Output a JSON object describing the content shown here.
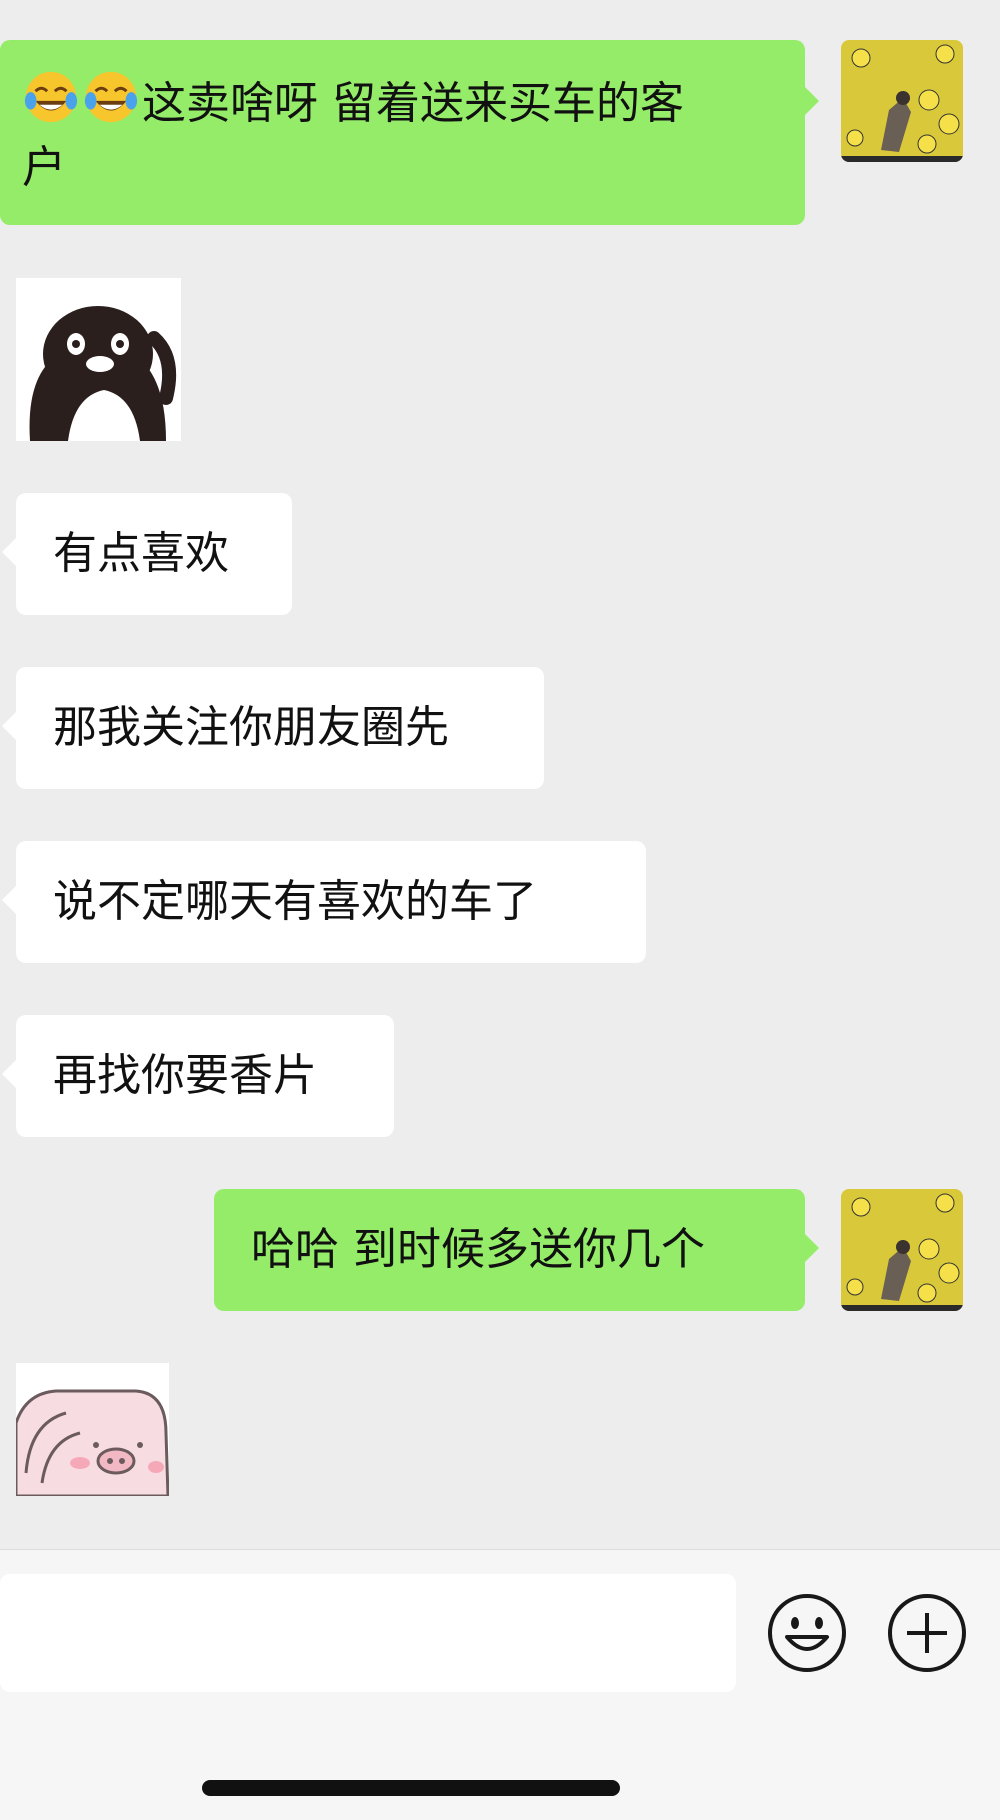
{
  "conversation": {
    "messages": [
      {
        "sender": "me",
        "type": "text",
        "emoji": "tears-of-joy x2",
        "text": "这卖啥呀 留着送来买车的客",
        "text_line2": "户"
      },
      {
        "sender": "them",
        "type": "sticker",
        "sticker": "penguin-salute-sticker"
      },
      {
        "sender": "them",
        "type": "text",
        "text": "有点喜欢"
      },
      {
        "sender": "them",
        "type": "text",
        "text": "那我关注你朋友圈先"
      },
      {
        "sender": "them",
        "type": "text",
        "text": "说不定哪天有喜欢的车了"
      },
      {
        "sender": "them",
        "type": "text",
        "text": "再找你要香片"
      },
      {
        "sender": "me",
        "type": "text",
        "text": "哈哈 到时候多送你几个"
      },
      {
        "sender": "them",
        "type": "sticker",
        "sticker": "pink-pig-sticker"
      }
    ]
  },
  "composer": {
    "input_value": "",
    "icons": [
      "smiley-icon",
      "plus-icon"
    ]
  },
  "colors": {
    "background": "#ededed",
    "my_bubble": "#95ec69",
    "their_bubble": "#ffffff",
    "avatar_yellow": "#d9c93a"
  }
}
